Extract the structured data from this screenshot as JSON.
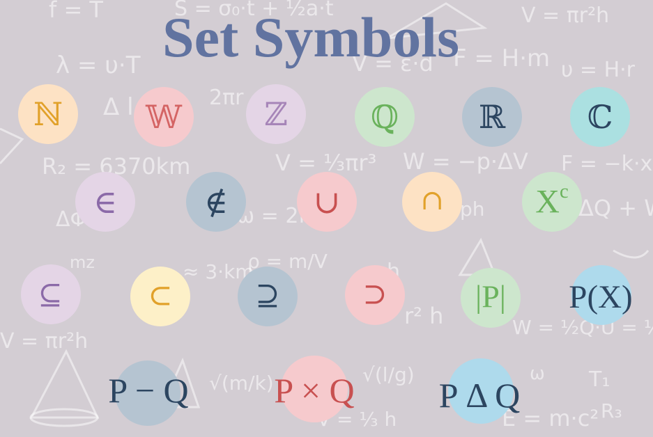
{
  "title": "Set Symbols",
  "colors": {
    "background": "#d3cdd3",
    "title": "#6173a0",
    "chip_peach": "#fde2c4",
    "chip_pink": "#f6cacd",
    "chip_lavender": "#e4d5e6",
    "chip_green": "#cde6cd",
    "chip_slate": "#b5c4d1",
    "chip_teal": "#abe0e1",
    "chip_yellow": "#fdf0c8",
    "chip_blue": "#aedaec"
  },
  "symbols": {
    "naturals": "ℕ",
    "wholes": "𝕎",
    "integers": "ℤ",
    "rationals": "ℚ",
    "reals": "ℝ",
    "complex": "ℂ",
    "element_of": "∈",
    "not_element_of": "∉",
    "union": "∪",
    "intersection": "∩",
    "complement_base": "X",
    "complement_sup": "c",
    "subset_eq": "⊆",
    "subset": "⊂",
    "superset_eq": "⊇",
    "superset": "⊃",
    "cardinality": "|P|",
    "power_set": "P(X)",
    "difference": "P − Q",
    "cartesian_product": "P × Q",
    "symmetric_difference": "P Δ Q"
  },
  "background_formulas": {
    "f1": "f = T",
    "f2": "S = σ₀·t + ½a·t",
    "f3": "V = πr²h",
    "f4": "λ = υ·T",
    "f5": "V = ε·d",
    "f6": "F = H·m",
    "f7": "υ = H·r",
    "f8": "R₂ = 6370km",
    "f9": "V = ⅓πr³",
    "f10": "W = −p·ΔV",
    "f11": "F = −k·x",
    "f12": "ω = 2π/T",
    "f13": "ω",
    "f14": "ΔQ + W",
    "f15": "h",
    "f16": "ph",
    "f17": "≈ 3·km",
    "f18": "mz",
    "f19": "ρ = m/V",
    "f20": "W = ½Q·U = ½C",
    "f21": "r² h",
    "f22": "√(m/k)",
    "f23": "√(l/g)",
    "f24": "T₁",
    "f25": "E = m·c²",
    "f26": "R₃",
    "f27": "Δ l",
    "f28": "2πr",
    "f29": "ΔΦ",
    "f30": "V = πr²h",
    "f31": "V = ⅓ h"
  }
}
